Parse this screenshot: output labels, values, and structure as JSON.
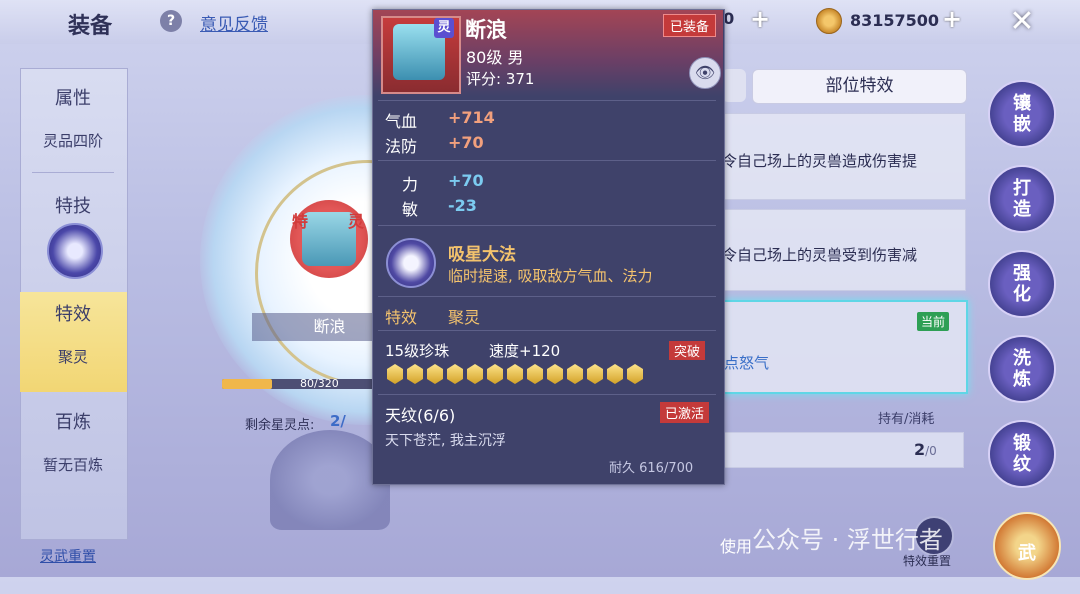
{
  "header": {
    "title": "装备",
    "help": "?",
    "feedback": "意见反馈",
    "currency_partial": "50",
    "currency_value": "83157500",
    "plus": "+",
    "close": "✕"
  },
  "sidebar": {
    "items": [
      {
        "head": "属性",
        "value": "灵品四阶"
      },
      {
        "head": "特技",
        "value": ""
      },
      {
        "head": "特效",
        "value": "聚灵"
      },
      {
        "head": "百炼",
        "value": "暂无百炼"
      }
    ],
    "reset_link": "灵武重置"
  },
  "center": {
    "badge_chars": [
      "特",
      "灵"
    ],
    "pet_name": "断浪",
    "exp_text": "80/320",
    "exp_fraction": 0.25,
    "star_label": "剩余星灵点:",
    "star_value": "2/"
  },
  "tooltip": {
    "ling_badge": "灵",
    "name": "断浪",
    "level": "80级 男",
    "score": "评分: 371",
    "equipped": "已装备",
    "stats": [
      {
        "label": "气血",
        "value": "+714"
      },
      {
        "label": "法防",
        "value": "+70"
      }
    ],
    "attrs": [
      {
        "label": "力",
        "value": "+70"
      },
      {
        "label": "敏",
        "value": "-23"
      }
    ],
    "skill_name": "吸星大法",
    "skill_desc": "临时提速, 吸取敌方气血、法力",
    "effect_label": "特效",
    "effect_value": "聚灵",
    "pearl": "15级珍珠",
    "speed": "速度+120",
    "breakthrough": "突破",
    "gem_count": 13,
    "tianwen": "天纹(6/6)",
    "activated": "已激活",
    "tianwen_desc": "天下苍茫, 我主沉浮",
    "durability": "耐久 616/700"
  },
  "right_panel": {
    "tab_label": "部位特效",
    "cards": [
      "令自己场上的灵兽造成伤害提",
      "令自己场上的灵兽受到伤害减",
      "点怒气"
    ],
    "current_badge": "当前",
    "hold_label": "持有/消耗",
    "hold_have": "2",
    "hold_cost": "/0",
    "use_label": "使用",
    "reset_label": "特效重置"
  },
  "action_buttons": [
    "镶嵌",
    "打造",
    "强化",
    "洗炼",
    "锻纹",
    "武"
  ],
  "watermark": "公众号 · 浮世行者",
  "colors": {
    "accent_red": "#c43a3a",
    "gold_text": "#f4c36d",
    "positive": "#f2a07d",
    "attr_blue": "#7ccbf0",
    "current_green": "#2e9f55"
  }
}
